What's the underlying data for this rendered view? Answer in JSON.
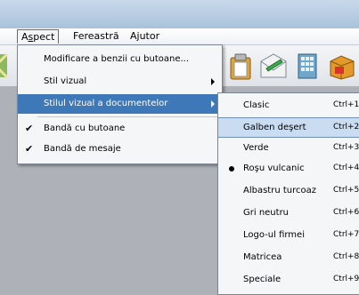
{
  "menubar": {
    "items": [
      {
        "label": "Aspect",
        "underline_index": 1
      },
      {
        "label": "Fereastră"
      },
      {
        "label": "Ajutor"
      }
    ]
  },
  "aspect_menu": {
    "items": [
      {
        "label": "Modificare a benzii cu butoane...",
        "has_submenu": false,
        "checked": false
      },
      {
        "label": "Stil vizual",
        "has_submenu": true,
        "checked": false
      },
      {
        "label": "Stilul vizual a documentelor",
        "has_submenu": true,
        "checked": false,
        "highlighted": true
      },
      {
        "label": "Bandă cu butoane",
        "has_submenu": false,
        "checked": true
      },
      {
        "label": "Bandă de mesaje",
        "has_submenu": false,
        "checked": true
      }
    ]
  },
  "style_submenu": {
    "items": [
      {
        "label": "Clasic",
        "shortcut": "Ctrl+1"
      },
      {
        "label": "Galben deşert",
        "shortcut": "Ctrl+2",
        "hovered": true
      },
      {
        "label": "Verde",
        "shortcut": "Ctrl+3"
      },
      {
        "label": "Roşu vulcanic",
        "shortcut": "Ctrl+4",
        "selected": true
      },
      {
        "label": "Albastru turcoaz",
        "shortcut": "Ctrl+5"
      },
      {
        "label": "Gri neutru",
        "shortcut": "Ctrl+6"
      },
      {
        "label": "Logo-ul firmei",
        "shortcut": "Ctrl+7"
      },
      {
        "label": "Matricea",
        "shortcut": "Ctrl+8"
      },
      {
        "label": "Speciale",
        "shortcut": "Ctrl+9"
      }
    ]
  },
  "toolbar": {
    "icons": [
      "pattern-icon",
      "clipboard-paste-icon",
      "email-compose-icon",
      "building-icon",
      "box-icon"
    ]
  },
  "colors": {
    "highlight": "#3f78b8",
    "hover": "#c9dcf2",
    "menu_bg": "#f5f6f8",
    "workspace": "#aeb2b8"
  }
}
